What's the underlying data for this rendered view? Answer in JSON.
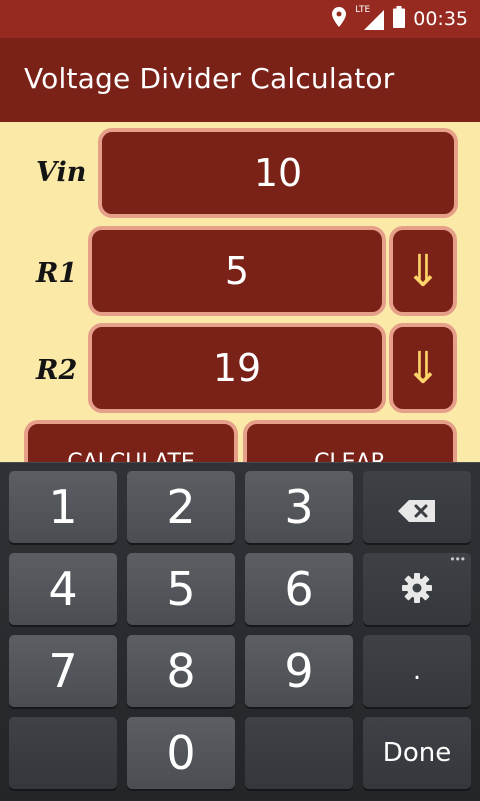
{
  "status_bar": {
    "time": "00:35",
    "network": "LTE"
  },
  "app_bar": {
    "title": "Voltage Divider Calculator"
  },
  "form": {
    "vin_label": "Vin",
    "vin_value": "10",
    "r1_label": "R1",
    "r1_value": "5",
    "r2_label": "R2",
    "r2_value": "19",
    "arrow_glyph": "⇓",
    "calculate_label": "CALCULATE",
    "clear_label": "CLEAR"
  },
  "keyboard": {
    "keys": [
      "1",
      "2",
      "3",
      "4",
      "5",
      "6",
      "7",
      "8",
      "9",
      "0",
      ".",
      "Done"
    ],
    "more_indicator": "•••"
  },
  "colors": {
    "status_bar": "#962a20",
    "app_bar": "#7a2118",
    "background": "#fbe9a8",
    "field": "#7a2118",
    "field_border": "#e6a08a",
    "arrow": "#ffd56a"
  }
}
